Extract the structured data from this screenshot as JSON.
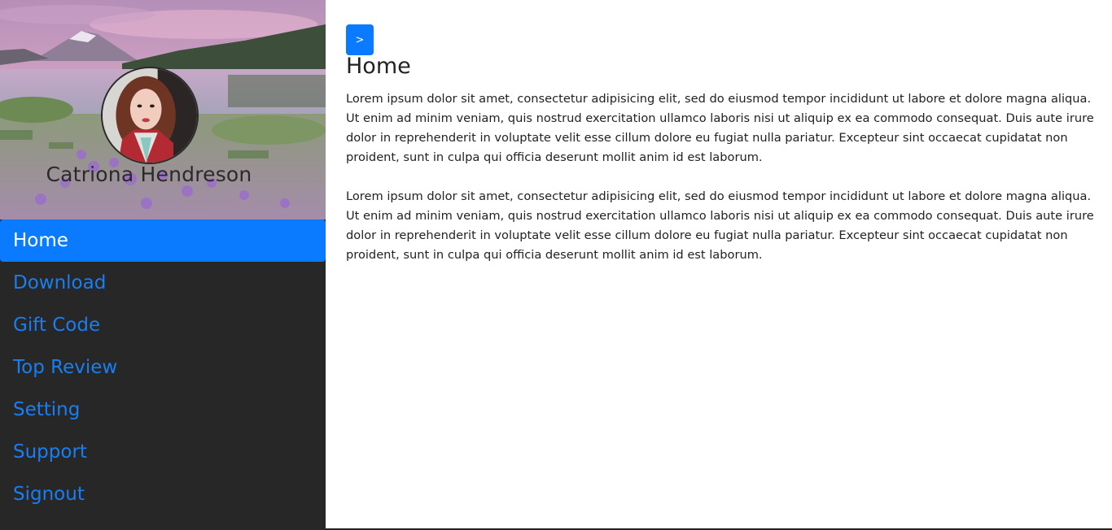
{
  "profile": {
    "name": "Catriona Hendreson"
  },
  "sidebar": {
    "items": [
      {
        "label": "Home"
      },
      {
        "label": "Download"
      },
      {
        "label": "Gift Code"
      },
      {
        "label": "Top Review"
      },
      {
        "label": "Setting"
      },
      {
        "label": "Support"
      },
      {
        "label": "Signout"
      }
    ],
    "active_index": 0
  },
  "toolbar": {
    "toggle_label": ">"
  },
  "main": {
    "title": "Home",
    "paragraphs": [
      "Lorem ipsum dolor sit amet, consectetur adipisicing elit, sed do eiusmod tempor incididunt ut labore et dolore magna aliqua. Ut enim ad minim veniam, quis nostrud exercitation ullamco laboris nisi ut aliquip ex ea commodo consequat. Duis aute irure dolor in reprehenderit in voluptate velit esse cillum dolore eu fugiat nulla pariatur. Excepteur sint occaecat cupidatat non proident, sunt in culpa qui officia deserunt mollit anim id est laborum.",
      "Lorem ipsum dolor sit amet, consectetur adipisicing elit, sed do eiusmod tempor incididunt ut labore et dolore magna aliqua. Ut enim ad minim veniam, quis nostrud exercitation ullamco laboris nisi ut aliquip ex ea commodo consequat. Duis aute irure dolor in reprehenderit in voluptate velit esse cillum dolore eu fugiat nulla pariatur. Excepteur sint occaecat cupidatat non proident, sunt in culpa qui officia deserunt mollit anim id est laborum."
    ]
  },
  "colors": {
    "sidebar_bg": "#272727",
    "accent": "#0a7bff",
    "link": "#1a7ef0"
  }
}
